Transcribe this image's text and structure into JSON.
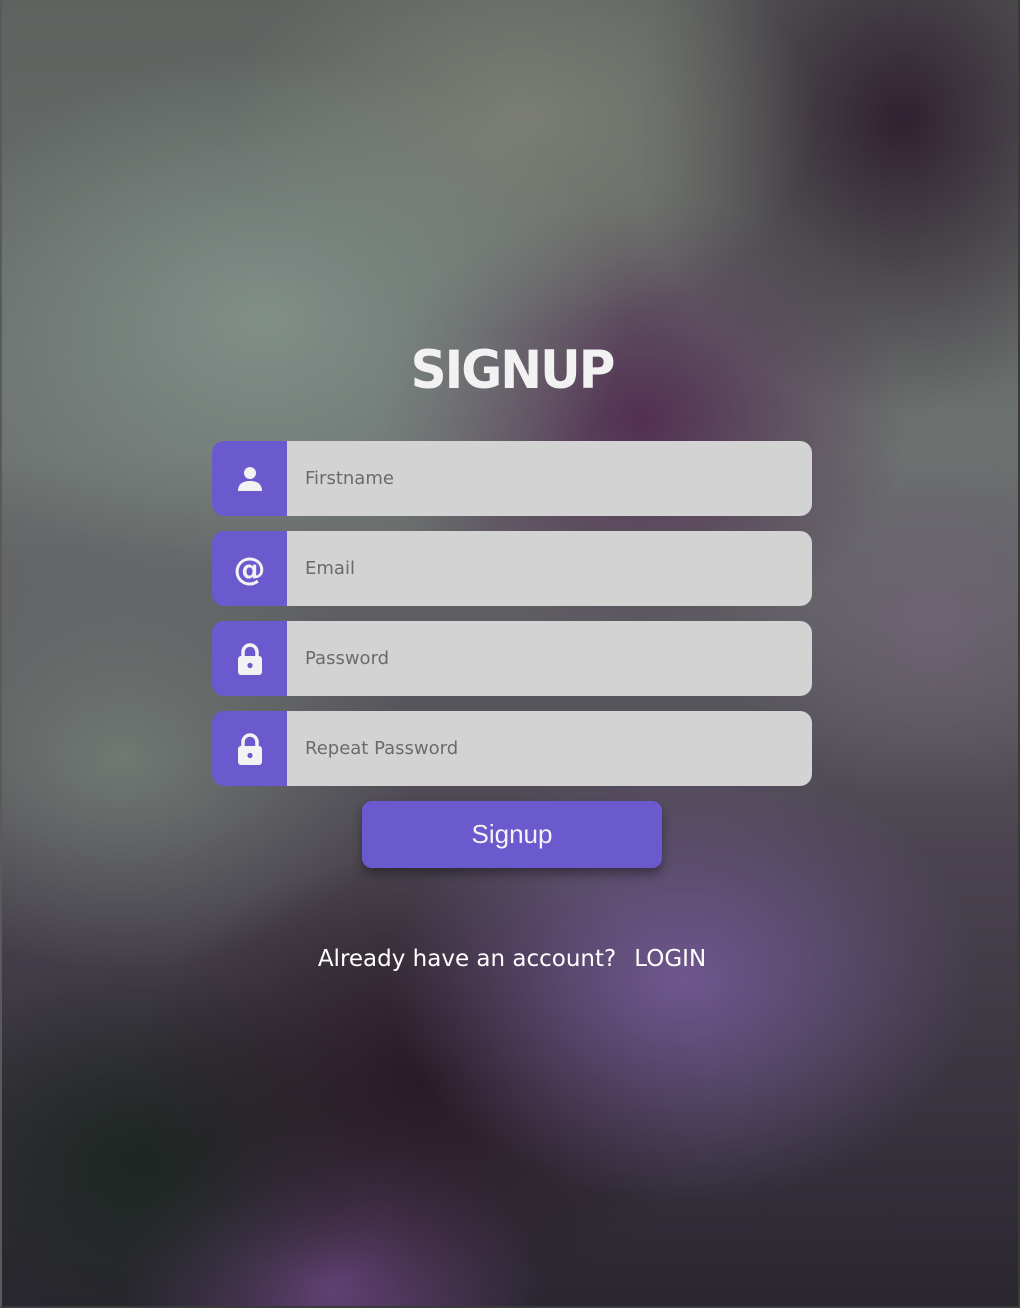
{
  "page": {
    "title": "SIGNUP"
  },
  "form": {
    "fields": [
      {
        "name": "firstname",
        "icon": "user-icon",
        "placeholder": "Firstname",
        "value": ""
      },
      {
        "name": "email",
        "icon": "at-icon",
        "placeholder": "Email",
        "value": ""
      },
      {
        "name": "password",
        "icon": "lock-icon",
        "placeholder": "Password",
        "value": ""
      },
      {
        "name": "repeat_password",
        "icon": "lock-icon",
        "placeholder": "Repeat Password",
        "value": ""
      }
    ],
    "submit_label": "Signup"
  },
  "footer": {
    "prompt": "Already have an account?",
    "login_label": "LOGIN"
  },
  "colors": {
    "accent": "#6a5acd",
    "input_bg": "#d3d3d3",
    "text_light": "#ffffff"
  }
}
